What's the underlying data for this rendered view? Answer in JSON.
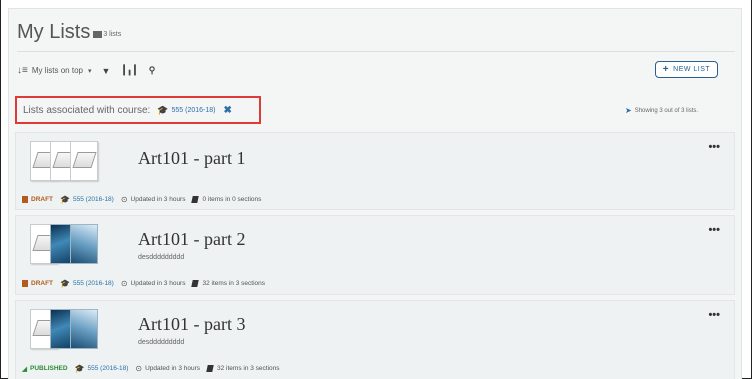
{
  "header": {
    "title": "My Lists",
    "count_icon": "list-icon",
    "count_text": "3 lists"
  },
  "toolbar": {
    "sort_icon": "sort-icon",
    "sort_label": "My lists on top",
    "sort_caret": "▾",
    "filter_icon": "filter-icon",
    "chart_icon": "chart-icon",
    "search_icon": "search-icon",
    "new_list_label": "NEW LIST"
  },
  "course_filter": {
    "label": "Lists associated with course:",
    "course_code": "555 (2016-18)",
    "remove_icon": "close-icon"
  },
  "showing_text": "Showing 3 out of 3 lists.",
  "lists": [
    {
      "title": "Art101 - part 1",
      "description": "",
      "status": "DRAFT",
      "course": "555 (2016-18)",
      "updated": "Updated in 3 hours",
      "items": "0 items in 0 sections",
      "more": "•••"
    },
    {
      "title": "Art101 - part 2",
      "description": "desddddddddd",
      "status": "DRAFT",
      "course": "555 (2016-18)",
      "updated": "Updated in 3 hours",
      "items": "32 items in 3 sections",
      "more": "•••"
    },
    {
      "title": "Art101 - part 3",
      "description": "desddddddddd",
      "status": "PUBLISHED",
      "course": "555 (2016-18)",
      "updated": "Updated in 3 hours",
      "items": "32 items in 3 sections",
      "more": "•••"
    }
  ],
  "colors": {
    "accent": "#2a6fa8",
    "draft": "#b35b1e",
    "published": "#2e8b3a",
    "highlight_border": "#e03a36"
  }
}
